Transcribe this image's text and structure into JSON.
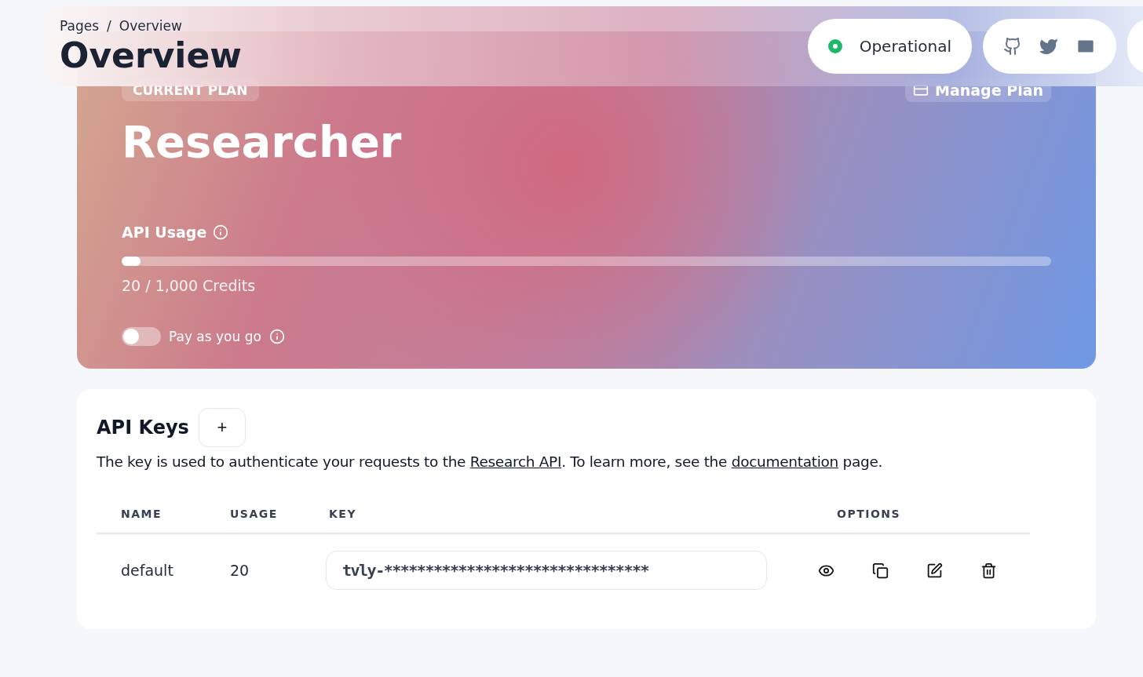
{
  "breadcrumb": [
    "Pages",
    "/",
    "Overview"
  ],
  "title": "Overview",
  "status": {
    "label": "Operational",
    "color": "#1fb86b"
  },
  "plan": {
    "badge": "CURRENT PLAN",
    "manage_button": "Manage Plan",
    "name": "Researcher",
    "usage_title": "API Usage",
    "usage": {
      "level": 0.02
    },
    "credits": "20 / 1,000 Credits",
    "pay_as_you_go": {
      "label": "Pay as you go",
      "on": false
    }
  },
  "keys": {
    "title": "API Keys",
    "add_button": "+",
    "description": [
      "The key is used to authenticate your requests to the ",
      "Research API",
      ". To learn more, see the ",
      "documentation",
      " page."
    ],
    "columns": [
      "NAME",
      "USAGE",
      "KEY",
      "OPTIONS"
    ],
    "rows": [
      {
        "name": "default",
        "usage": "20",
        "key": "tvly-********************************"
      }
    ]
  }
}
